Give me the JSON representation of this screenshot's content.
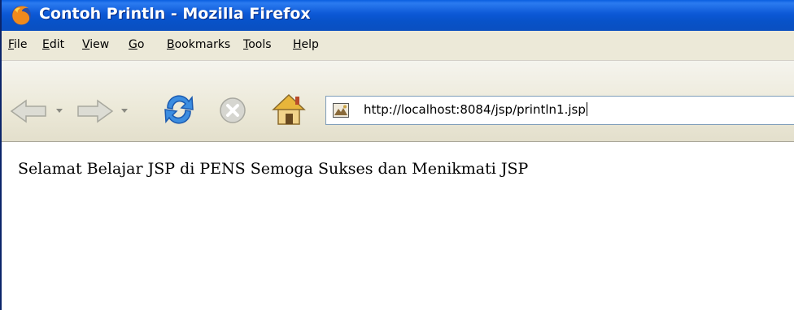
{
  "window": {
    "title": "Contoh Println - Mozilla Firefox"
  },
  "menubar": {
    "items": [
      "File",
      "Edit",
      "View",
      "Go",
      "Bookmarks",
      "Tools",
      "Help"
    ]
  },
  "toolbar": {
    "icons": [
      "back-arrow-icon",
      "dropdown-arrow-icon",
      "forward-arrow-icon",
      "dropdown-arrow-icon",
      "reload-icon",
      "stop-icon",
      "home-icon"
    ],
    "address": "http://localhost:8084/jsp/println1.jsp"
  },
  "page": {
    "text": "Selamat Belajar JSP di PENS Semoga Sukses dan Menikmati JSP"
  },
  "colors": {
    "titlebar": "#0a58d6",
    "chrome": "#ece9d8",
    "url_border": "#7f9db9"
  }
}
